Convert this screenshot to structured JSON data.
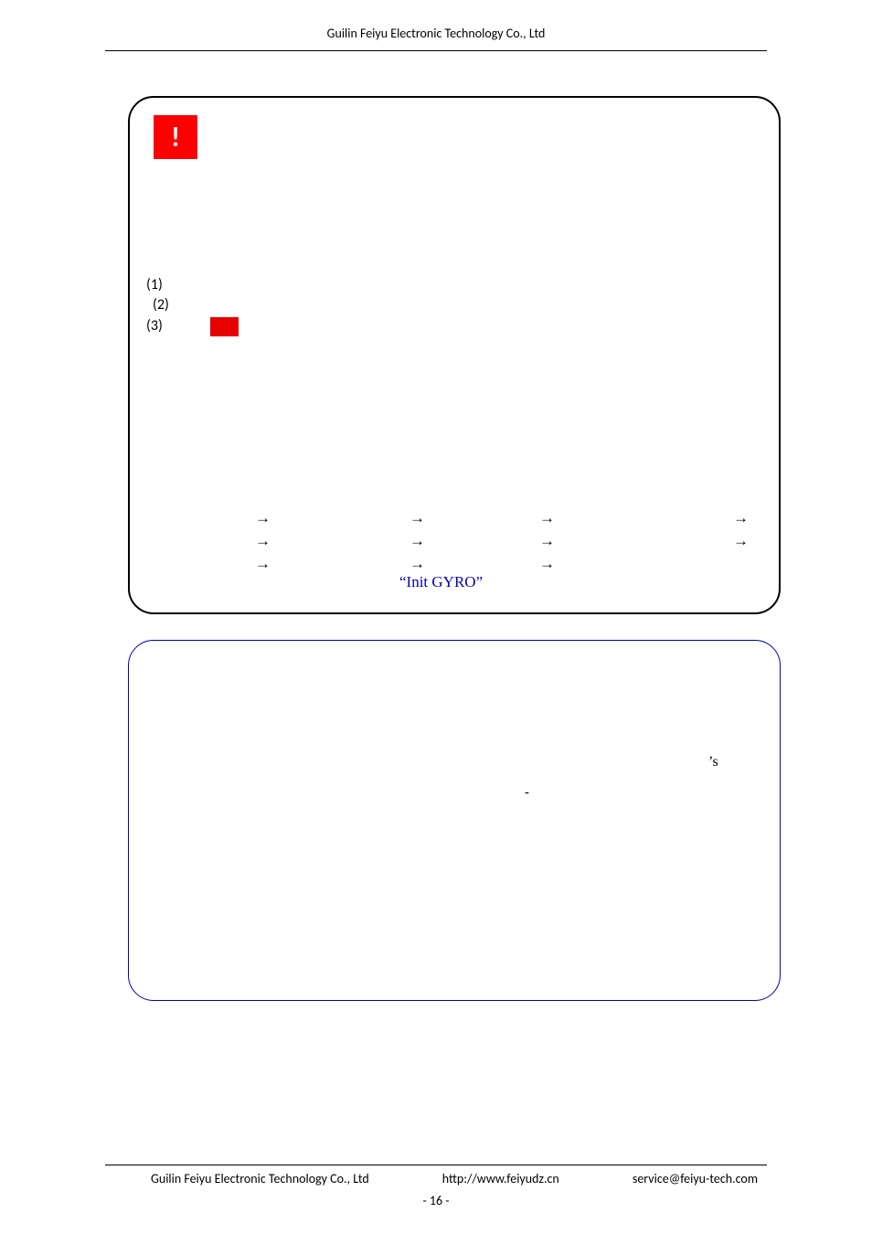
{
  "header": {
    "company": "Guilin Feiyu Electronic Technology Co., Ltd"
  },
  "warning_mark": "!",
  "list": {
    "item1": "(1)",
    "item2": "(2)",
    "item3": "(3)"
  },
  "arrow": "→",
  "init_gyro": "“Init GYRO”",
  "apostrophe_s": "’s",
  "dash": "-",
  "footer": {
    "left": "Guilin Feiyu Electronic Technology Co., Ltd",
    "mid": "http://www.feiyudz.cn",
    "right": "service@feiyu-tech.com",
    "page": "- 16 -"
  }
}
